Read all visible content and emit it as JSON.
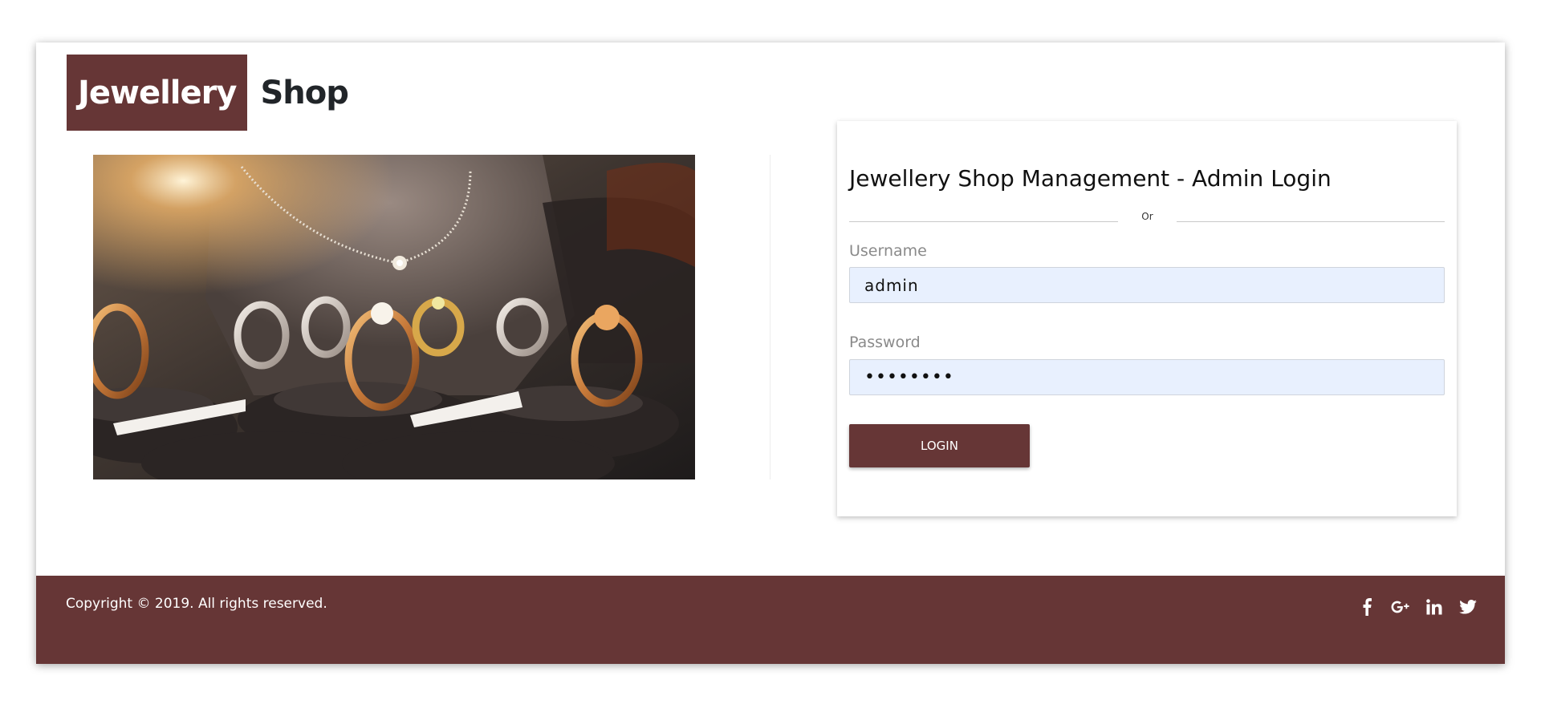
{
  "brand": {
    "highlight": "Jewellery",
    "rest": "Shop"
  },
  "login": {
    "title": "Jewellery Shop Management - Admin Login",
    "divider_text": "Or",
    "username_label": "Username",
    "username_value": "admin",
    "password_label": "Password",
    "password_value": "••••••••",
    "button_label": "LOGIN"
  },
  "footer": {
    "copyright": "Copyright © 2019. All rights reserved.",
    "social_icons": [
      "facebook-icon",
      "google-plus-icon",
      "linkedin-icon",
      "twitter-icon"
    ]
  },
  "colors": {
    "brand": "#663636",
    "input_bg": "#e8f0fe"
  }
}
